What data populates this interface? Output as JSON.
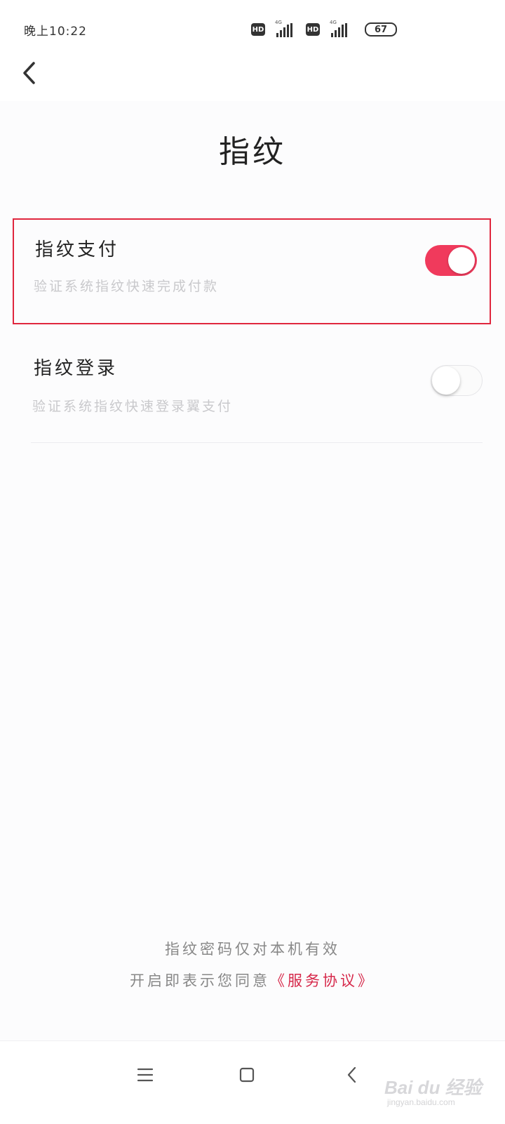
{
  "status_bar": {
    "time": "晚上10:22",
    "hd_badge": "HD",
    "network": "4G",
    "battery": "67"
  },
  "header": {
    "back_icon": "chevron-left-icon",
    "title": "指纹"
  },
  "settings": [
    {
      "title": "指纹支付",
      "subtitle": "验证系统指纹快速完成付款",
      "enabled": true
    },
    {
      "title": "指纹登录",
      "subtitle": "验证系统指纹快速登录翼支付",
      "enabled": false
    }
  ],
  "footer": {
    "note": "指纹密码仅对本机有效",
    "agree_prefix": "开启即表示您同意",
    "agree_link": "《服务协议》"
  },
  "nav_bar": {
    "icons": [
      "menu-icon",
      "home-icon",
      "back-icon"
    ]
  },
  "watermark": {
    "text": "Bai du 经验",
    "url": "jingyan.baidu.com"
  },
  "colors": {
    "accent": "#f03a5c",
    "highlight_border": "#e0263e",
    "link": "#d6284a"
  }
}
